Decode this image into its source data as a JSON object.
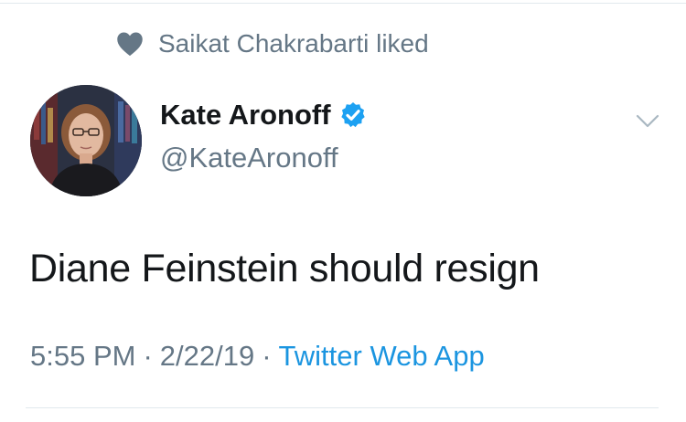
{
  "social_context": {
    "icon": "heart-icon",
    "text": "Saikat Chakrabarti liked"
  },
  "author": {
    "display_name": "Kate Aronoff",
    "handle": "@KateAronoff",
    "verified": true,
    "verified_icon": "verified-badge-icon",
    "avatar_icon": "avatar"
  },
  "tweet": {
    "text": "Diane Feinstein should resign"
  },
  "meta": {
    "time": "5:55 PM",
    "separator": "·",
    "date": "2/22/19",
    "source": "Twitter Web App"
  },
  "menu": {
    "icon": "chevron-down-icon"
  },
  "colors": {
    "text_primary": "#14171a",
    "text_secondary": "#657786",
    "link": "#1b95e0",
    "verified": "#1da1f2",
    "border": "#e1e8ed"
  }
}
